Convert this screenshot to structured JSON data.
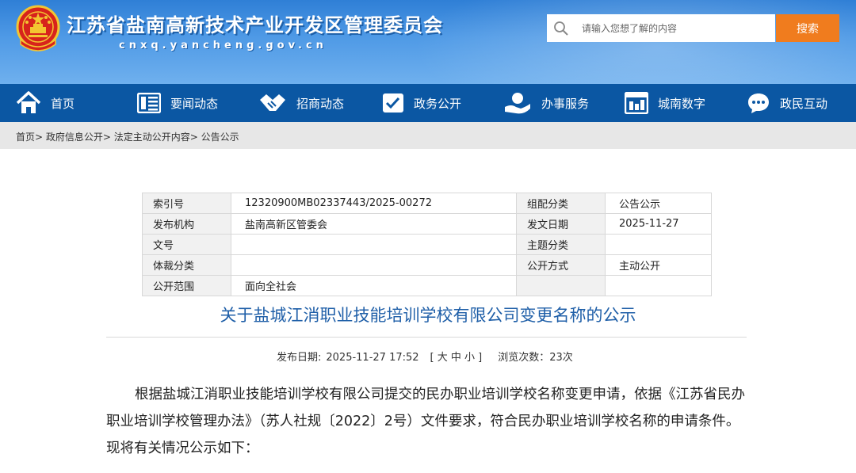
{
  "header": {
    "site_title": "江苏省盐南高新技术产业开发区管理委员会",
    "site_domain": "cnxq.yancheng.gov.cn",
    "search_placeholder": "请输入您想了解的内容",
    "search_button": "搜索"
  },
  "nav": {
    "items": [
      {
        "label": "首页",
        "icon": "home-icon"
      },
      {
        "label": "要闻动态",
        "icon": "news-icon"
      },
      {
        "label": "招商动态",
        "icon": "handshake-icon"
      },
      {
        "label": "政务公开",
        "icon": "check-document-icon"
      },
      {
        "label": "办事服务",
        "icon": "service-hand-icon"
      },
      {
        "label": "城南数字",
        "icon": "digital-city-icon"
      },
      {
        "label": "政民互动",
        "icon": "chat-icon"
      }
    ]
  },
  "breadcrumb": {
    "text": "首页> 政府信息公开> 法定主动公开内容> 公告公示"
  },
  "info": {
    "index_label": "索引号",
    "index_value": "12320900MB02337443/2025-00272",
    "category_label": "组配分类",
    "category_value": "公告公示",
    "publisher_label": "发布机构",
    "publisher_value": "盐南高新区管委会",
    "date_label": "发文日期",
    "date_value": "2025-11-27",
    "docno_label": "文号",
    "docno_value": "",
    "topic_label": "主题分类",
    "topic_value": "",
    "genre_label": "体裁分类",
    "genre_value": "",
    "method_label": "公开方式",
    "method_value": "主动公开",
    "scope_label": "公开范围",
    "scope_value": "面向全社会"
  },
  "article": {
    "title": "关于盐城江消职业技能培训学校有限公司变更名称的公示",
    "publish_label": "发布日期:",
    "publish_date": "2025-11-27 17:52",
    "font_size_label": "[ 大 中 小 ]",
    "views_label": "浏览次数：23次",
    "body": "根据盐城江消职业技能培训学校有限公司提交的民办职业培训学校名称变更申请，依据《江苏省民办职业培训学校管理办法》（苏人社规〔2022〕2号）文件要求，符合民办职业培训学校名称的申请条件。现将有关情况公示如下："
  },
  "colors": {
    "header_blue": "#2f7fd6",
    "nav_blue": "#0b57a3",
    "search_orange": "#f07c1e",
    "title_blue": "#1f5fa8"
  }
}
